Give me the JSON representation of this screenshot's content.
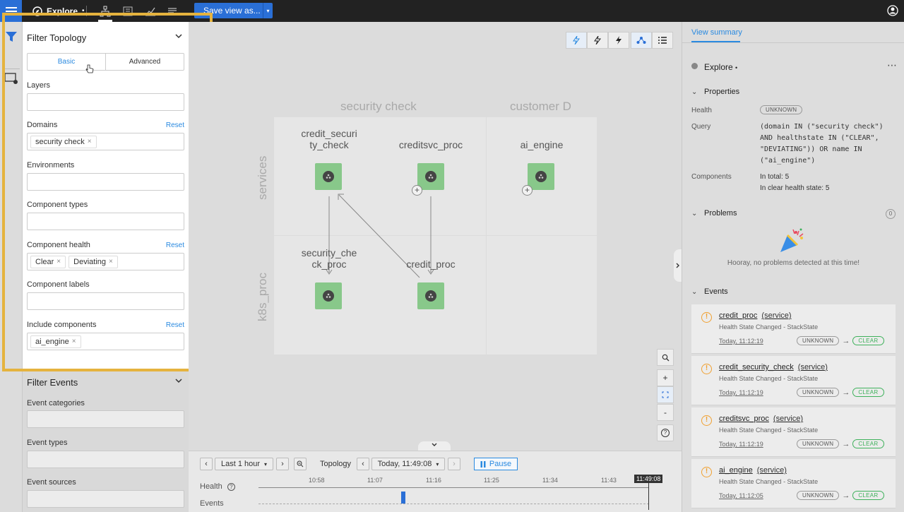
{
  "topbar": {
    "title": "Explore",
    "title_mark": "•",
    "save_view": "Save view as...",
    "save_view_dropdown": "▾"
  },
  "filter_topology": {
    "title": "Filter Topology",
    "tabs": [
      "Basic",
      "Advanced"
    ],
    "fields": {
      "layers": {
        "label": "Layers"
      },
      "domains": {
        "label": "Domains",
        "reset": "Reset",
        "chips": [
          "security check"
        ]
      },
      "environments": {
        "label": "Environments"
      },
      "component_types": {
        "label": "Component types"
      },
      "component_health": {
        "label": "Component health",
        "reset": "Reset",
        "chips": [
          "Clear",
          "Deviating"
        ]
      },
      "component_labels": {
        "label": "Component labels"
      },
      "include_components": {
        "label": "Include components",
        "reset": "Reset",
        "chips": [
          "ai_engine"
        ]
      }
    }
  },
  "filter_events": {
    "title": "Filter Events",
    "fields": [
      "Event categories",
      "Event types",
      "Event sources"
    ]
  },
  "canvas": {
    "columns": [
      "security check",
      "customer D"
    ],
    "rows": [
      "services",
      "k8s_proc"
    ],
    "nodes": [
      {
        "label": "credit_securi\nty_check"
      },
      {
        "label": "creditsvc_proc"
      },
      {
        "label": "ai_engine"
      },
      {
        "label": "security_che\nck_proc"
      },
      {
        "label": "credit_proc"
      }
    ],
    "zoom_buttons": [
      "+",
      "-",
      "?"
    ]
  },
  "timeline": {
    "range": "Last 1 hour",
    "mode": "Topology",
    "time": "Today, 11:49:08",
    "pause": "Pause",
    "health_label": "Health",
    "events_label": "Events",
    "ticks": [
      "10:58",
      "11:07",
      "11:16",
      "11:25",
      "11:34",
      "11:43"
    ],
    "now": "11:49:08"
  },
  "summary": {
    "tab": "View summary",
    "title": "Explore",
    "title_mark": "•",
    "properties_title": "Properties",
    "health_key": "Health",
    "health_value": "UNKNOWN",
    "query_key": "Query",
    "query_value": "(domain IN (\"security check\") AND healthstate IN (\"CLEAR\", \"DEVIATING\")) OR name IN (\"ai_engine\")",
    "components_key": "Components",
    "components_total": "In total: 5",
    "components_clear": "In clear health state: 5",
    "problems_title": "Problems",
    "problems_count": "0",
    "problems_empty": "Hooray, no problems detected at this time!",
    "events_title": "Events",
    "events": [
      {
        "name": "credit_proc",
        "kind": "(service)",
        "desc": "Health State Changed  -  StackState",
        "time": "Today, 11:12:19",
        "from": "UNKNOWN",
        "to": "CLEAR"
      },
      {
        "name": "credit_security_check",
        "kind": "(service)",
        "desc": "Health State Changed  -  StackState",
        "time": "Today, 11:12:19",
        "from": "UNKNOWN",
        "to": "CLEAR"
      },
      {
        "name": "creditsvc_proc",
        "kind": "(service)",
        "desc": "Health State Changed  -  StackState",
        "time": "Today, 11:12:19",
        "from": "UNKNOWN",
        "to": "CLEAR"
      },
      {
        "name": "ai_engine",
        "kind": "(service)",
        "desc": "Health State Changed  -  StackState",
        "time": "Today, 11:12:05",
        "from": "UNKNOWN",
        "to": "CLEAR"
      }
    ]
  },
  "colors": {
    "accent": "#2a8ae0",
    "brand_blue": "#2a6fd6",
    "node_green": "#88c88a",
    "highlight": "#e5b33e",
    "clear_green": "#3eb15b",
    "warning": "#f0a030"
  },
  "icons": [
    "menu-icon",
    "compass-icon",
    "topology-icon",
    "list-view-icon",
    "chart-icon",
    "text-icon",
    "user-icon",
    "filter-icon",
    "visualization-settings-icon",
    "lightning-icon",
    "search-icon",
    "fit-icon",
    "party-popper-icon",
    "warning-icon"
  ]
}
